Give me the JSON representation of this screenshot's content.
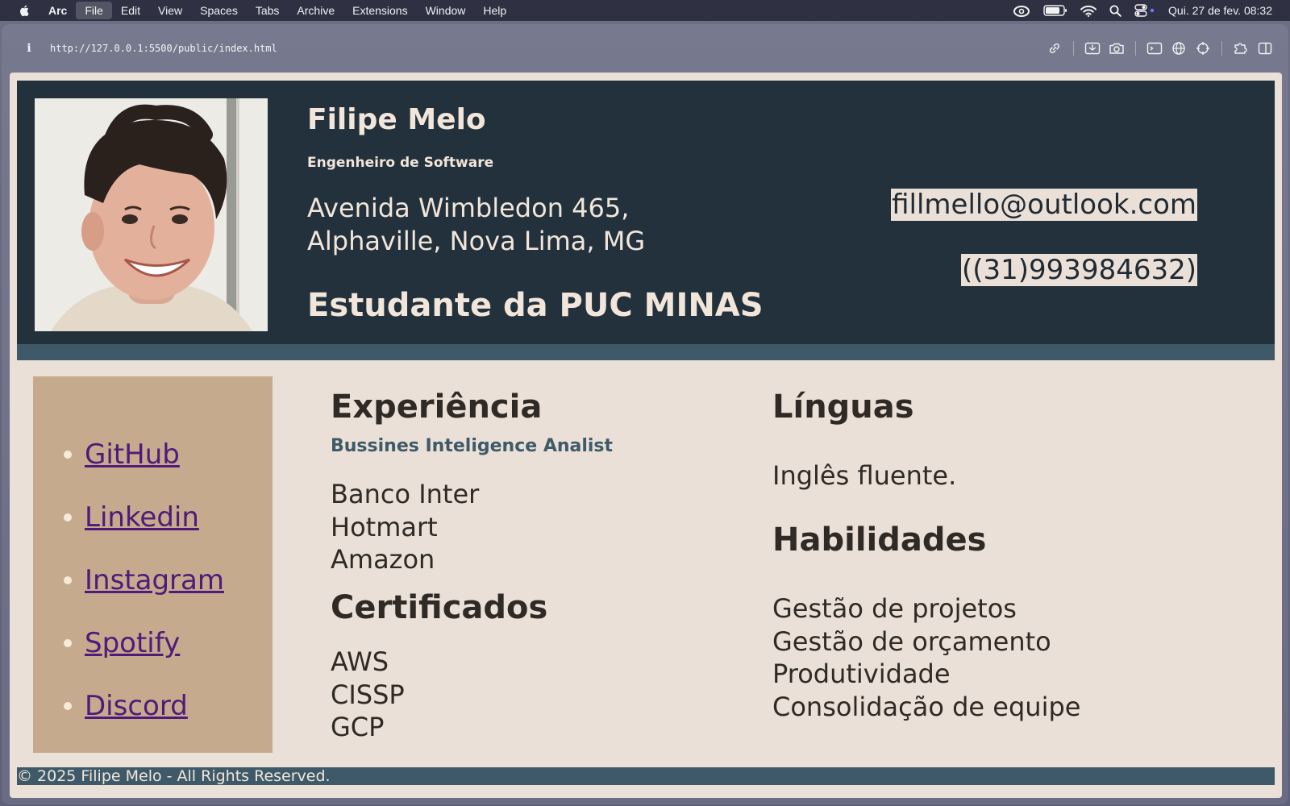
{
  "menubar": {
    "app": "Arc",
    "items": [
      "File",
      "Edit",
      "View",
      "Spaces",
      "Tabs",
      "Archive",
      "Extensions",
      "Window",
      "Help"
    ],
    "clock": "Qui. 27 de fev.  08:32"
  },
  "browser": {
    "url": "http://127.0.0.1:5500/public/index.html",
    "info_glyph": "i"
  },
  "profile": {
    "name": "Filipe Melo",
    "role": "Engenheiro de Software",
    "address_line1": "Avenida Wimbledon 465,",
    "address_line2": "Alphaville, Nova Lima, MG",
    "study": "Estudante da PUC MINAS",
    "email": "fillmello@outlook.com",
    "phone": "((31)993984632)"
  },
  "links": [
    "GitHub",
    "Linkedin",
    "Instagram",
    "Spotify",
    "Discord"
  ],
  "experience": {
    "title": "Experiência",
    "subtitle": "Bussines Inteligence Analist",
    "items": [
      "Banco Inter",
      "Hotmart",
      "Amazon"
    ]
  },
  "certificates": {
    "title": "Certificados",
    "items": [
      "AWS",
      "CISSP",
      "GCP"
    ]
  },
  "languages": {
    "title": "Línguas",
    "items": [
      "Inglês fluente."
    ]
  },
  "skills": {
    "title": "Habilidades",
    "items": [
      "Gestão de projetos",
      "Gestão de orçamento",
      "Produtividade",
      "Consolidação de equipe"
    ]
  },
  "footer": "© 2025 Filipe Melo - All Rights Reserved.",
  "colors": {
    "header_bg": "#22313b",
    "accent": "#3e5a69",
    "page_bg": "#ebe0d7",
    "sidebar_bg": "#c5aa8d",
    "link": "#4f1a7a"
  }
}
